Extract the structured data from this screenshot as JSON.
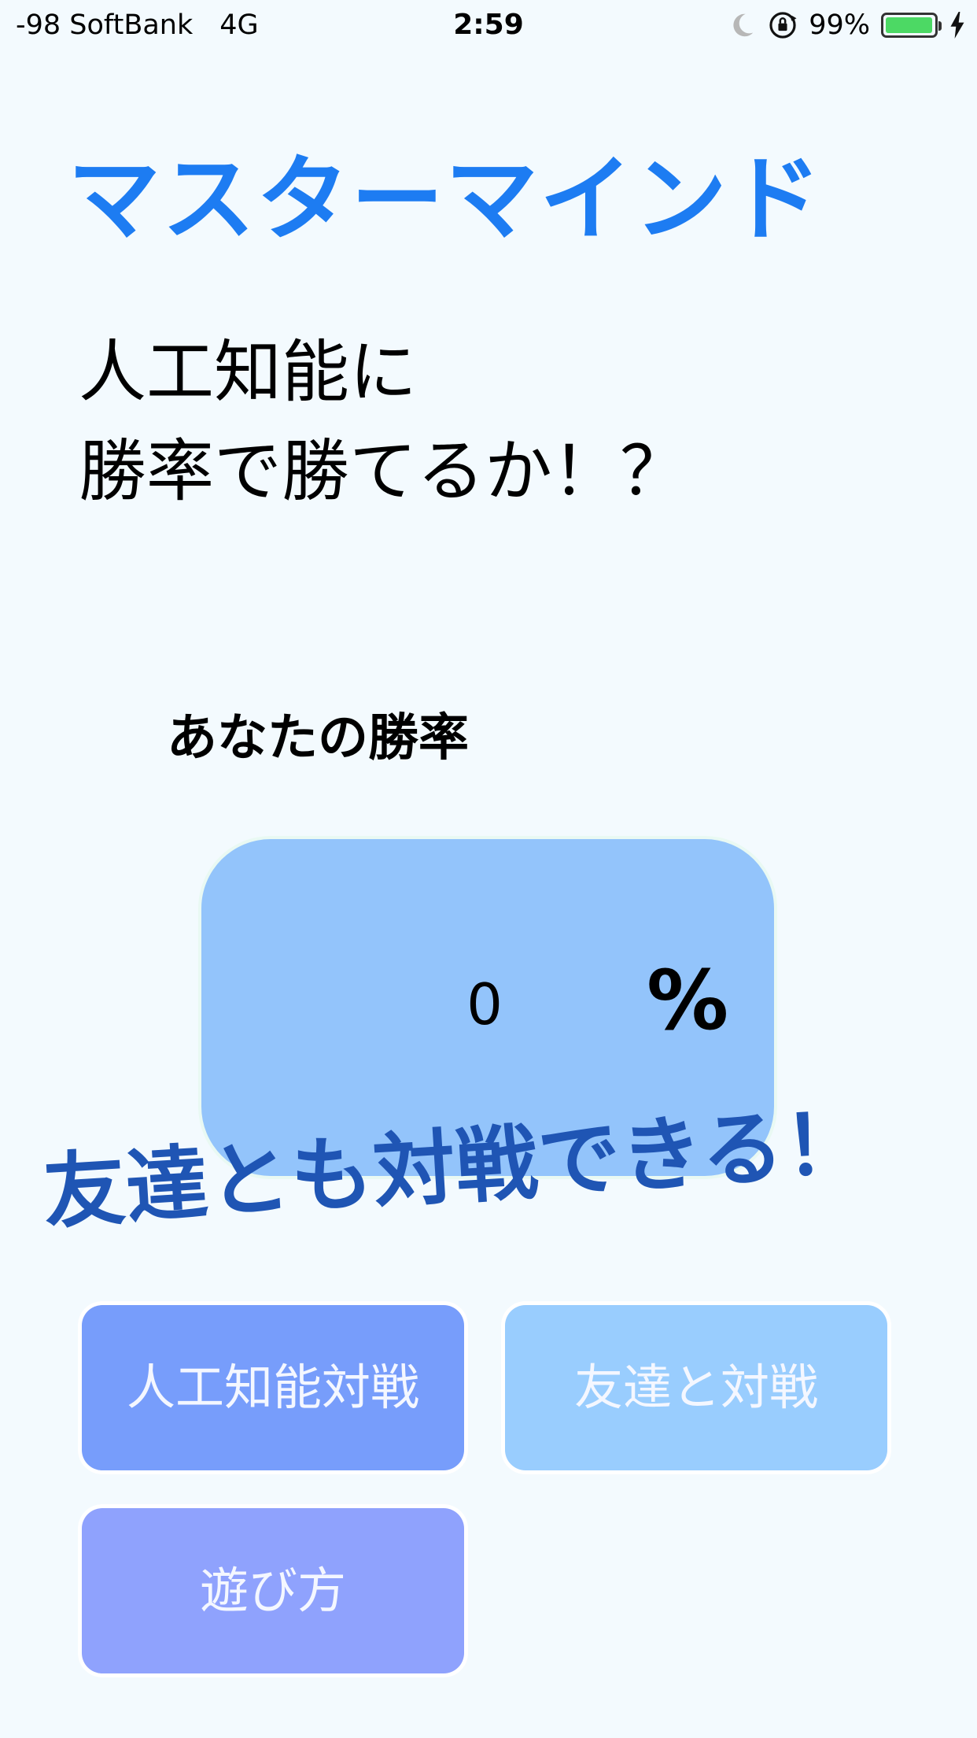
{
  "status_bar": {
    "carrier": "-98 SoftBank",
    "network": "4G",
    "time": "2:59",
    "battery_percent": "99%",
    "battery_level": 0.99,
    "battery_color": "#4cd964",
    "icons": [
      "moon-icon",
      "orientation-lock-icon",
      "battery-icon",
      "charging-bolt-icon"
    ]
  },
  "header": {
    "title": "マスターマインド",
    "title_color": "#1d7cf2",
    "tagline_line1": "人工知能に",
    "tagline_line2": "勝率で勝てるか！？"
  },
  "winrate": {
    "label": "あなたの勝率",
    "value": "0",
    "unit": "%",
    "box_color": "#93c4fb"
  },
  "banner": {
    "text": "友達とも対戦できる！",
    "color": "#1f55b4"
  },
  "buttons": {
    "ai_battle": "人工知能対戦",
    "friend_battle": "友達と対戦",
    "how_to_play": "遊び方",
    "colors": {
      "ai_battle": "#779dfb",
      "friend_battle": "#99cdfe",
      "how_to_play": "#8fa2fd"
    }
  }
}
